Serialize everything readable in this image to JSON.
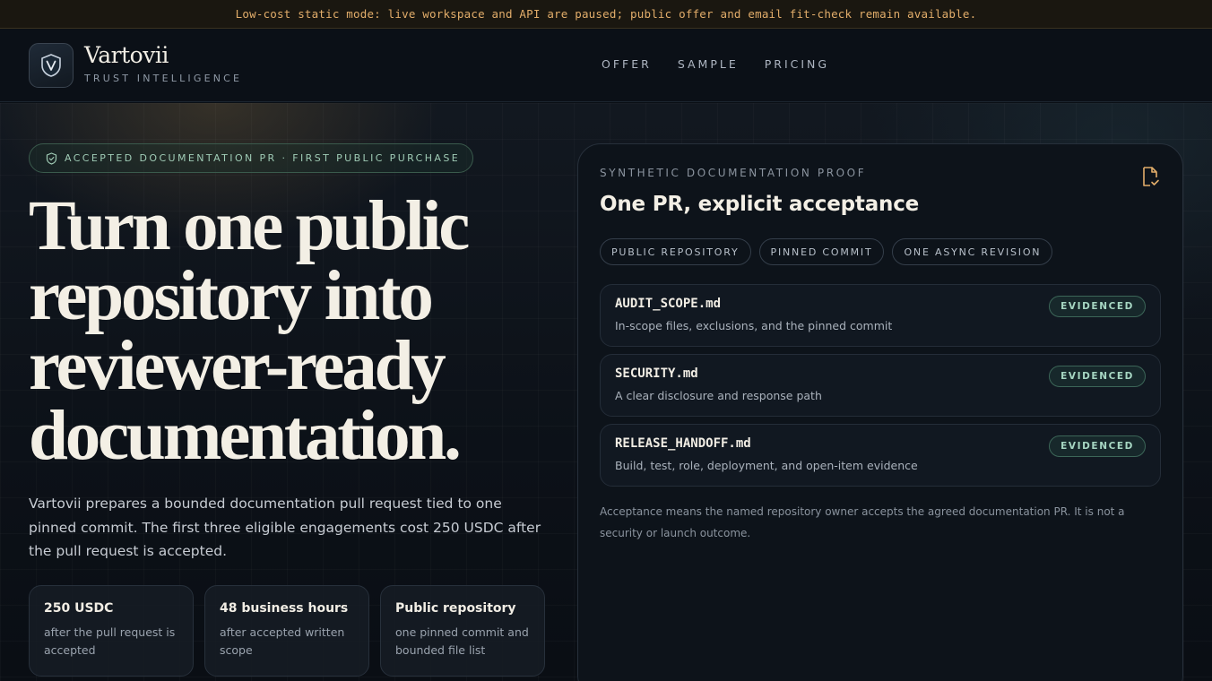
{
  "banner": {
    "text": "Low-cost static mode: live workspace and API are paused; public offer and email fit-check remain available."
  },
  "header": {
    "brand_name": "Vartovii",
    "brand_sub": "TRUST INTELLIGENCE",
    "logo_icon": "shield-v-icon",
    "nav": [
      {
        "label": "OFFER"
      },
      {
        "label": "SAMPLE"
      },
      {
        "label": "PRICING"
      }
    ]
  },
  "hero": {
    "pill_text": "ACCEPTED DOCUMENTATION PR · FIRST PUBLIC PURCHASE",
    "headline": "Turn one public repository into reviewer-ready documentation.",
    "lede": "Vartovii prepares a bounded documentation pull request tied to one pinned commit. The first three eligible engagements cost 250 USDC after the pull request is accepted.",
    "stats": [
      {
        "title": "250 USDC",
        "desc": "after the pull request is accepted"
      },
      {
        "title": "48 business hours",
        "desc": "after accepted written scope"
      },
      {
        "title": "Public repository",
        "desc": "one pinned commit and bounded file list"
      }
    ]
  },
  "proof": {
    "eyebrow": "SYNTHETIC DOCUMENTATION PROOF",
    "title": "One PR, explicit acceptance",
    "icon": "document-check-icon",
    "chips": [
      {
        "label": "PUBLIC REPOSITORY"
      },
      {
        "label": "PINNED COMMIT"
      },
      {
        "label": "ONE ASYNC REVISION"
      }
    ],
    "files": [
      {
        "name": "AUDIT_SCOPE.md",
        "desc": "In-scope files, exclusions, and the pinned commit",
        "badge": "EVIDENCED"
      },
      {
        "name": "SECURITY.md",
        "desc": "A clear disclosure and response path",
        "badge": "EVIDENCED"
      },
      {
        "name": "RELEASE_HANDOFF.md",
        "desc": "Build, test, role, deployment, and open-item evidence",
        "badge": "EVIDENCED"
      }
    ],
    "note": "Acceptance means the named repository owner accepts the agreed documentation PR. It is not a security or launch outcome."
  },
  "colors": {
    "accent_amber": "#e2ad6a",
    "accent_green": "#9fcbb5",
    "background": "#0a0f15"
  }
}
